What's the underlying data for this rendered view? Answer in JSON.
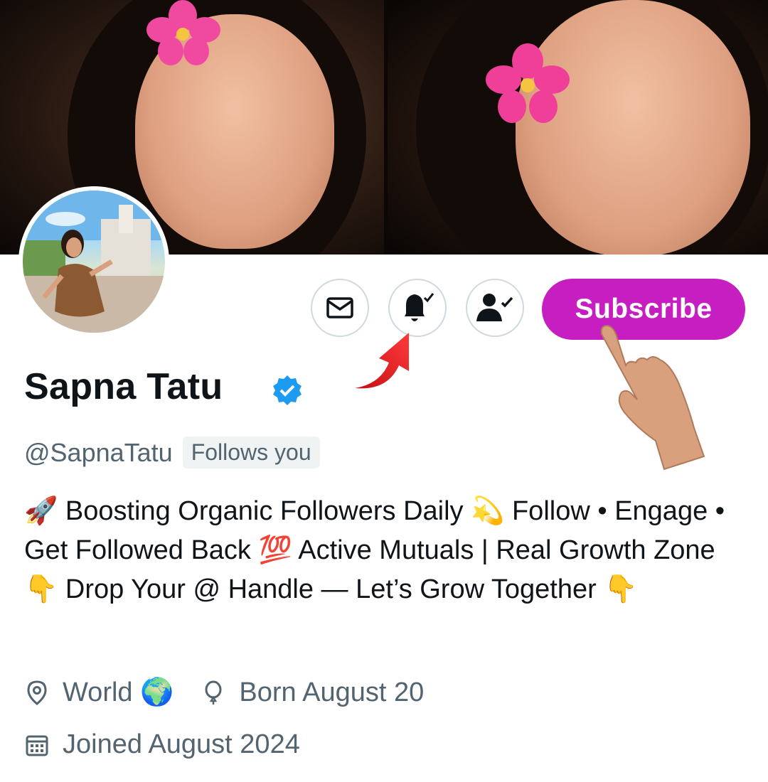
{
  "profile": {
    "name": "Sapna Tatu",
    "handle": "@SapnaTatu",
    "follows_badge": "Follows you",
    "verified_icon": "verified-badge-icon",
    "bio": "🚀 Boosting Organic Followers Daily 💫 Follow • Engage • Get Followed Back 💯 Active Mutuals | Real Growth Zone 👇 Drop Your @ Handle — Let’s Grow Together 👇",
    "location": "World 🌍",
    "birthday": "Born August 20",
    "joined": "Joined August 2024"
  },
  "actions": {
    "message_icon": "envelope-icon",
    "notify_icon": "bell-check-icon",
    "follow_icon": "person-check-icon",
    "subscribe_label": "Subscribe"
  },
  "colors": {
    "subscribe_bg": "#c71ec2",
    "verified_blue": "#1d9bf0",
    "secondary_text": "#536471",
    "arrow_red": "#e11a1a"
  }
}
